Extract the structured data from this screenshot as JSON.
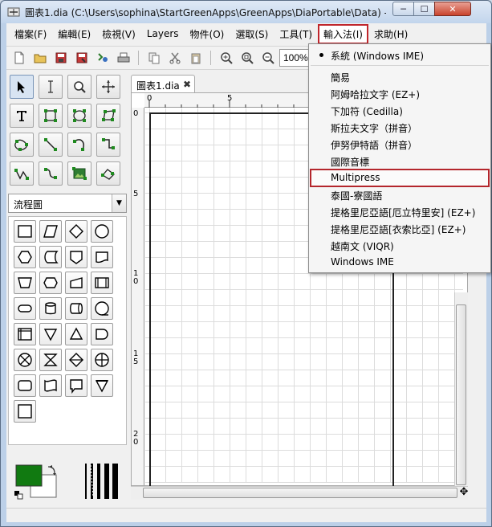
{
  "window": {
    "title": "圖表1.dia (C:\\Users\\sophina\\StartGreenApps\\GreenApps\\DiaPortable\\Data) - di...",
    "minimize_glyph": "─",
    "maximize_glyph": "☐",
    "close_glyph": "✕"
  },
  "menubar": {
    "items": [
      {
        "label": "檔案(F)"
      },
      {
        "label": "編輯(E)"
      },
      {
        "label": "檢視(V)"
      },
      {
        "label": "Layers"
      },
      {
        "label": "物件(O)"
      },
      {
        "label": "選取(S)"
      },
      {
        "label": "工具(T)"
      },
      {
        "label": "輸入法(I)"
      },
      {
        "label": "求助(H)"
      }
    ]
  },
  "toolbar": {
    "zoom_value": "100%",
    "icons": [
      "new-file-icon",
      "open-folder-icon",
      "save-icon",
      "save-as-icon",
      "export-icon",
      "print-icon",
      "copy-icon",
      "cut-icon",
      "paste-icon",
      "zoom-in-icon",
      "zoom-fit-icon",
      "zoom-out-icon"
    ]
  },
  "toolbox": {
    "tools": [
      "pointer-tool",
      "text-cursor-tool",
      "magnify-tool",
      "move-tool",
      "text-tool",
      "box-tool",
      "ellipse-tool",
      "polygon-tool",
      "beziergon-tool",
      "line-tool",
      "arc-tool",
      "zigzag-tool",
      "polyline-tool",
      "bezier-tool",
      "image-tool",
      "outline-tool"
    ],
    "sheet_selected": "流程圖",
    "colors": {
      "foreground": "#117a11",
      "background": "#ffffff"
    }
  },
  "document": {
    "tab_label": "圖表1.dia",
    "ruler_h": [
      "0",
      "5"
    ],
    "ruler_v": [
      "0",
      "5",
      "1\n0",
      "1\n5",
      "2\n0"
    ]
  },
  "ime_menu": {
    "items": [
      {
        "label": "系統 (Windows IME)",
        "checked": true
      },
      {
        "label": "簡易"
      },
      {
        "label": "阿姆哈拉文字 (EZ+)"
      },
      {
        "label": "下加符 (Cedilla)"
      },
      {
        "label": "斯拉夫文字（拼音）"
      },
      {
        "label": "伊努伊特語（拼音）"
      },
      {
        "label": "國際音標"
      },
      {
        "label": "Multipress",
        "highlighted": true
      },
      {
        "label": "泰國-寮國語"
      },
      {
        "label": "提格里尼亞語[厄立特里安] (EZ+)"
      },
      {
        "label": "提格里尼亞語[衣索比亞] (EZ+)"
      },
      {
        "label": "越南文 (VIQR)"
      },
      {
        "label": "Windows IME"
      }
    ]
  }
}
